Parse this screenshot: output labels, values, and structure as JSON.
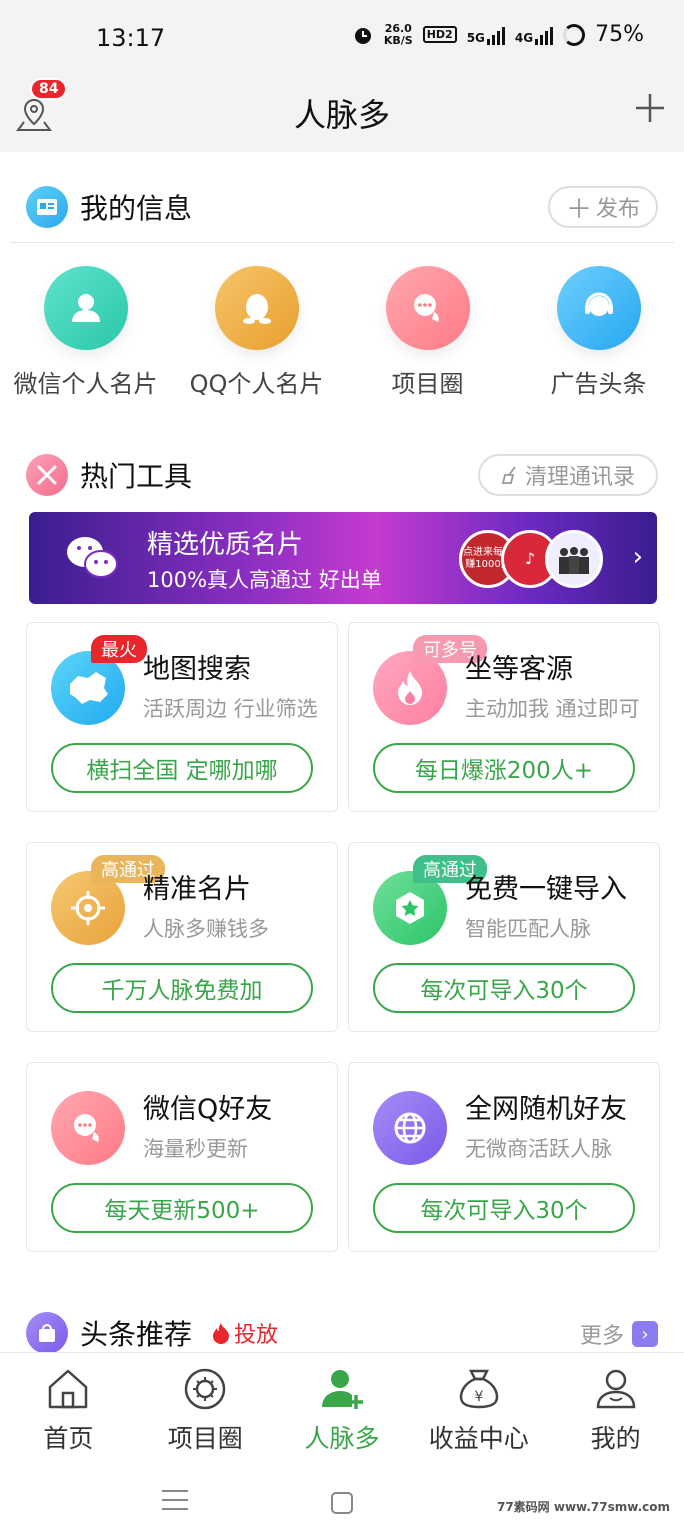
{
  "status_bar": {
    "time": "13:17",
    "speed_value": "26.0",
    "speed_unit": "KB/S",
    "hd": "HD2",
    "net1": "5G",
    "net2": "4G",
    "battery": "75%"
  },
  "header": {
    "title": "人脉多",
    "badge_count": "84"
  },
  "my_info": {
    "title": "我的信息",
    "publish_label": "发布",
    "items": [
      {
        "label": "微信个人名片",
        "icon": "person-icon",
        "color": "#3ed6bb"
      },
      {
        "label": "QQ个人名片",
        "icon": "qq-penguin-icon",
        "color": "#f0b24a"
      },
      {
        "label": "项目圈",
        "icon": "chat-bubble-icon",
        "color": "#ff8a95"
      },
      {
        "label": "广告头条",
        "icon": "headset-icon",
        "color": "#3fb8f5"
      }
    ]
  },
  "hot_tools": {
    "title": "热门工具",
    "clean_label": "清理通讯录",
    "banner": {
      "title": "精选优质名片",
      "subtitle": "100%真人高通过 好出单",
      "circle1": "点进来每天赚1000元",
      "circle2": "抖音"
    },
    "tools": [
      {
        "tag": "最火",
        "title": "地图搜索",
        "subtitle": "活跃周边 行业筛选",
        "button": "横扫全国 定哪加哪",
        "icon": "china-map-icon",
        "color": "#2bb7f0",
        "tag_color": "#e8262b"
      },
      {
        "tag": "可多号",
        "title": "坐等客源",
        "subtitle": "主动加我 通过即可",
        "button": "每日爆涨200人+",
        "icon": "flame-icon",
        "color": "#ff8aa8",
        "tag_color": "#f78fa5"
      },
      {
        "tag": "高通过",
        "title": "精准名片",
        "subtitle": "人脉多赚钱多",
        "button": "千万人脉免费加",
        "icon": "target-icon",
        "color": "#f0b44a",
        "tag_color": "#e8b55a"
      },
      {
        "tag": "高通过",
        "title": "免费一键导入",
        "subtitle": "智能匹配人脉",
        "button": "每次可导入30个",
        "icon": "star-hexagon-icon",
        "color": "#3fd07a",
        "tag_color": "#3fbf8a"
      },
      {
        "tag": "",
        "title": "微信Q好友",
        "subtitle": "海量秒更新",
        "button": "每天更新500+",
        "icon": "chat-bubbles-icon",
        "color": "#ff8a95",
        "tag_color": ""
      },
      {
        "tag": "",
        "title": "全网随机好友",
        "subtitle": "无微商活跃人脉",
        "button": "每次可导入30个",
        "icon": "globe-icon",
        "color": "#8b6cf0",
        "tag_color": ""
      }
    ]
  },
  "news": {
    "title": "头条推荐",
    "toufang": "投放",
    "more": "更多"
  },
  "tabbar": [
    {
      "label": "首页",
      "icon": "home-icon"
    },
    {
      "label": "项目圈",
      "icon": "circle-gear-icon"
    },
    {
      "label": "人脉多",
      "icon": "add-person-icon",
      "active": true
    },
    {
      "label": "收益中心",
      "icon": "money-bag-icon"
    },
    {
      "label": "我的",
      "icon": "user-icon"
    }
  ],
  "watermark": "77素码网 www.77smw.com"
}
